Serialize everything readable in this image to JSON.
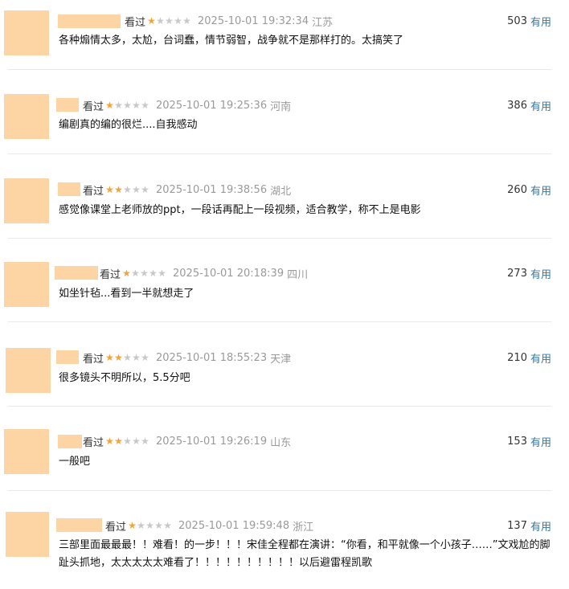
{
  "useful_label": "有用",
  "watched_label": "看过",
  "colors": {
    "accent_link": "#3377aa",
    "star_on": "#f2a33a",
    "star_off": "#c8c8c8",
    "avatar": "#fdd4a3"
  },
  "comments": [
    {
      "watched": "看过",
      "rating": 1,
      "time": "2025-10-01 19:32:34",
      "location": "江苏",
      "votes": "503",
      "text": "各种煽情太多，太尬，台词蠢，情节弱智，战争就不是那样打的。太搞笑了"
    },
    {
      "watched": "看过",
      "rating": 1,
      "time": "2025-10-01 19:25:36",
      "location": "河南",
      "votes": "386",
      "text": "编剧真的编的很烂....自我感动"
    },
    {
      "watched": "看过",
      "rating": 2,
      "time": "2025-10-01 19:38:56",
      "location": "湖北",
      "votes": "260",
      "text": "感觉像课堂上老师放的ppt，一段话再配上一段视频，适合教学，称不上是电影"
    },
    {
      "watched": "看过",
      "rating": 1,
      "time": "2025-10-01 20:18:39",
      "location": "四川",
      "votes": "273",
      "text": "如坐针毡...看到一半就想走了"
    },
    {
      "watched": "看过",
      "rating": 2,
      "time": "2025-10-01 18:55:23",
      "location": "天津",
      "votes": "210",
      "text": "很多镜头不明所以，5.5分吧"
    },
    {
      "watched": "看过",
      "rating": 2,
      "time": "2025-10-01 19:26:19",
      "location": "山东",
      "votes": "153",
      "text": "一般吧"
    },
    {
      "watched": "看过",
      "rating": 1,
      "time": "2025-10-01 19:59:48",
      "location": "浙江",
      "votes": "137",
      "text": "三部里面最最最！！难看！的一步！！！宋佳全程都在演讲：“你看，和平就像一个小孩子……”文戏尬的脚趾头抓地，太太太太太难看了！！！！！！！！！！以后避雷程凯歌"
    }
  ]
}
